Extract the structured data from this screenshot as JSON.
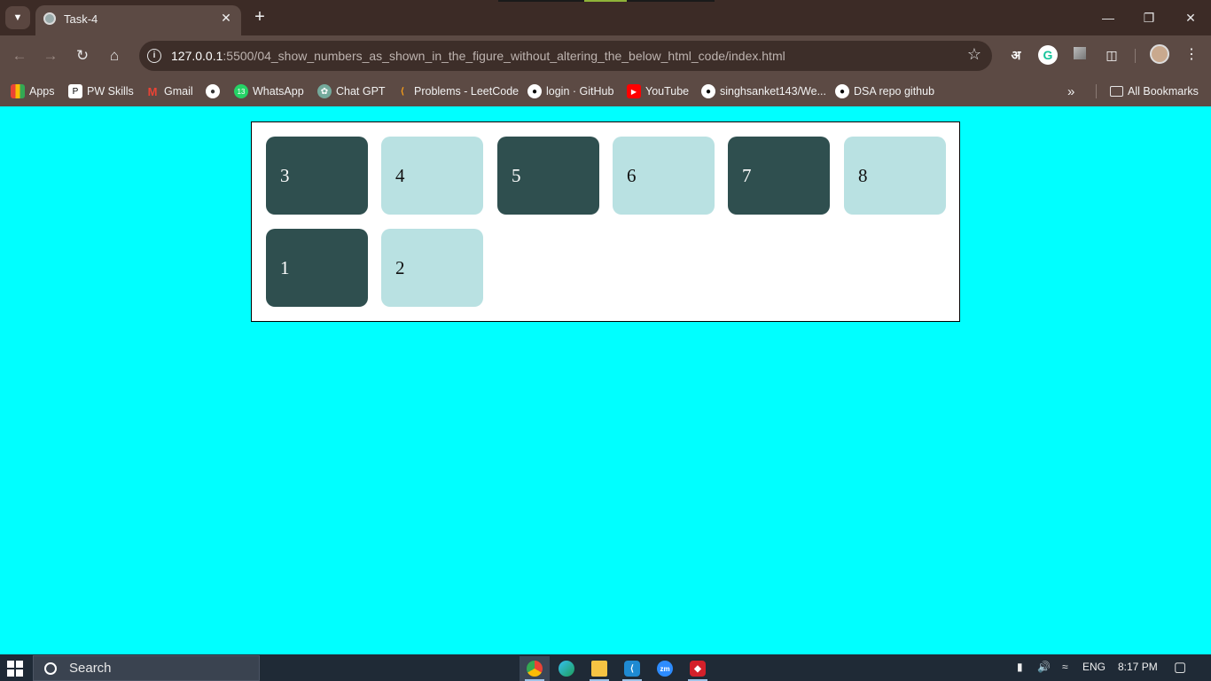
{
  "browser": {
    "tab_title": "Task-4",
    "url_host": "127.0.0.1",
    "url_path": ":5500/04_show_numbers_as_shown_in_the_figure_without_altering_the_below_html_code/index.html",
    "extension_letter": "अ",
    "bookmarks": [
      {
        "label": "Apps",
        "icon": "apps-grid-icon"
      },
      {
        "label": "PW Skills",
        "icon": "pw-skills-icon"
      },
      {
        "label": "Gmail",
        "icon": "gmail-icon"
      },
      {
        "label": "",
        "icon": "globe-icon"
      },
      {
        "label": "WhatsApp",
        "icon": "whatsapp-icon"
      },
      {
        "label": "Chat GPT",
        "icon": "chatgpt-icon"
      },
      {
        "label": "Problems - LeetCode",
        "icon": "leetcode-icon"
      },
      {
        "label": "login · GitHub",
        "icon": "github-icon"
      },
      {
        "label": "YouTube",
        "icon": "youtube-icon"
      },
      {
        "label": "singhsanket143/We...",
        "icon": "github-icon"
      },
      {
        "label": "DSA repo github",
        "icon": "github-icon"
      }
    ],
    "all_bookmarks_label": "All Bookmarks",
    "whatsapp_badge": "13"
  },
  "page": {
    "background": "#00ffff",
    "boxes": [
      {
        "label": "3",
        "style": "dark"
      },
      {
        "label": "4",
        "style": "light"
      },
      {
        "label": "5",
        "style": "dark"
      },
      {
        "label": "6",
        "style": "light"
      },
      {
        "label": "7",
        "style": "dark"
      },
      {
        "label": "8",
        "style": "light"
      },
      {
        "label": "1",
        "style": "dark"
      },
      {
        "label": "2",
        "style": "light"
      }
    ],
    "dark_color": "#2f4f4f",
    "light_color": "#b9e1e2"
  },
  "taskbar": {
    "search_label": "Search",
    "language": "ENG",
    "time": "8:17 PM",
    "apps": [
      "chrome-icon",
      "edge-icon",
      "file-explorer-icon",
      "vscode-icon",
      "zoom-icon",
      "acrobat-icon"
    ],
    "zoom_label": "zm"
  }
}
